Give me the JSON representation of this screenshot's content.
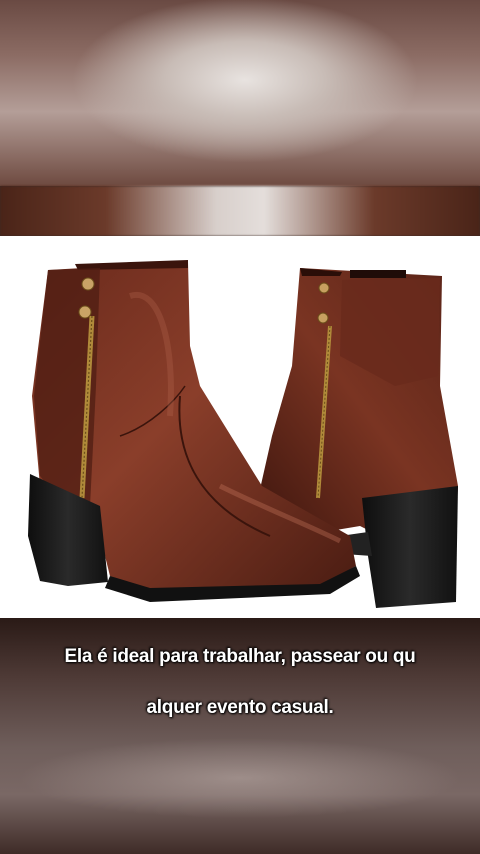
{
  "caption": {
    "line1": "Ela é ideal para trabalhar, passear ou qu",
    "line2": "alquer evento casual."
  },
  "colors": {
    "leather": "#5a2418",
    "leather_highlight": "#8a3e2a",
    "heel": "#1a1a1a",
    "zipper": "#b08a3a",
    "background_photo": "#ffffff"
  }
}
